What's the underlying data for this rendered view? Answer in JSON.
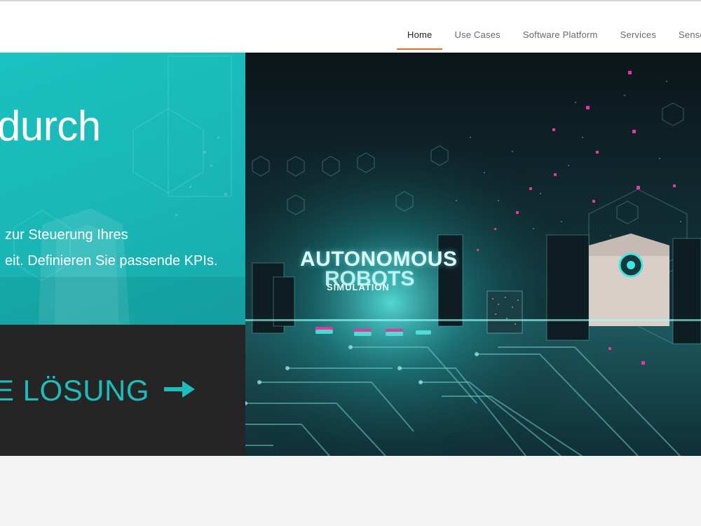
{
  "nav": {
    "items": [
      {
        "label": "Home",
        "active": true
      },
      {
        "label": "Use Cases",
        "active": false
      },
      {
        "label": "Software Platform",
        "active": false
      },
      {
        "label": "Services",
        "active": false
      },
      {
        "label": "Sensors",
        "active": false
      }
    ],
    "active_underline_color": "#e8701f"
  },
  "hero": {
    "title": "durch",
    "text_line1": "zur Steuerung Ihres",
    "text_line2": "eit. Definieren Sie passende KPIs.",
    "teal_color": "#1ab6b6",
    "cta": {
      "label": "E LÖSUNG",
      "arrow_icon": "arrow-right-icon",
      "color": "#1bbdbd",
      "background": "#252525"
    }
  },
  "image": {
    "overlay_title": "AUTONOMOUS",
    "overlay_subtitle": "ROBOTS",
    "overlay_small": "SIMULATION"
  }
}
